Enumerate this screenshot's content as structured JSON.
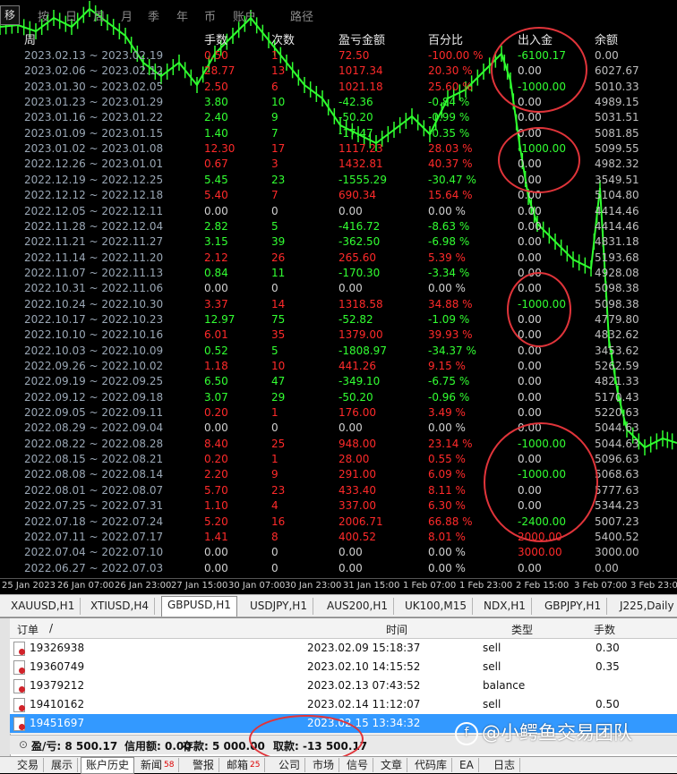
{
  "menu": {
    "left_box": "移",
    "items": [
      "按",
      "日",
      "周",
      "月",
      "季",
      "年",
      "币",
      "账户",
      "",
      "路径"
    ]
  },
  "columns": {
    "week": "周",
    "ratio": "手数",
    "count": "次数",
    "pnl": "盈亏金额",
    "pct": "百分比",
    "io": "出入金",
    "balance": "余额"
  },
  "rows": [
    {
      "week": "2023.02.13 ~ 2023.02.19",
      "ratio": "0.50",
      "count": "1",
      "pnl": "72.50",
      "pct": "-100.00 %",
      "io": "-6100.17",
      "balance": "0.00",
      "s": "neg",
      "ios": "pos"
    },
    {
      "week": "2023.02.06 ~ 2023.02.12",
      "ratio": "28.77",
      "count": "13",
      "pnl": "1017.34",
      "pct": "20.30 %",
      "io": "0.00",
      "balance": "6027.67",
      "s": "neg",
      "ios": "zero"
    },
    {
      "week": "2023.01.30 ~ 2023.02.05",
      "ratio": "2.50",
      "count": "6",
      "pnl": "1021.18",
      "pct": "25.60 %",
      "io": "-1000.00",
      "balance": "5010.33",
      "s": "neg",
      "ios": "pos"
    },
    {
      "week": "2023.01.23 ~ 2023.01.29",
      "ratio": "3.80",
      "count": "10",
      "pnl": "-42.36",
      "pct": "-0.84 %",
      "io": "0.00",
      "balance": "4989.15",
      "s": "pos",
      "ios": "zero"
    },
    {
      "week": "2023.01.16 ~ 2023.01.22",
      "ratio": "2.40",
      "count": "9",
      "pnl": "-50.20",
      "pct": "-0.99 %",
      "io": "0.00",
      "balance": "5031.51",
      "s": "pos",
      "ios": "zero"
    },
    {
      "week": "2023.01.09 ~ 2023.01.15",
      "ratio": "1.40",
      "count": "7",
      "pnl": "-17.47",
      "pct": "-0.35 %",
      "io": "0.00",
      "balance": "5081.85",
      "s": "pos",
      "ios": "zero"
    },
    {
      "week": "2023.01.02 ~ 2023.01.08",
      "ratio": "12.30",
      "count": "17",
      "pnl": "1117.23",
      "pct": "28.03 %",
      "io": "-1000.00",
      "balance": "5099.55",
      "s": "neg",
      "ios": "pos"
    },
    {
      "week": "2022.12.26 ~ 2023.01.01",
      "ratio": "0.67",
      "count": "3",
      "pnl": "1432.81",
      "pct": "40.37 %",
      "io": "0.00",
      "balance": "4982.32",
      "s": "neg",
      "ios": "zero"
    },
    {
      "week": "2022.12.19 ~ 2022.12.25",
      "ratio": "5.45",
      "count": "23",
      "pnl": "-1555.29",
      "pct": "-30.47 %",
      "io": "0.00",
      "balance": "3549.51",
      "s": "pos",
      "ios": "zero"
    },
    {
      "week": "2022.12.12 ~ 2022.12.18",
      "ratio": "5.40",
      "count": "7",
      "pnl": "690.34",
      "pct": "15.64 %",
      "io": "0.00",
      "balance": "5104.80",
      "s": "neg",
      "ios": "zero"
    },
    {
      "week": "2022.12.05 ~ 2022.12.11",
      "ratio": "0.00",
      "count": "0",
      "pnl": "0.00",
      "pct": "0.00 %",
      "io": "0.00",
      "balance": "4414.46",
      "s": "zero",
      "ios": "zero"
    },
    {
      "week": "2022.11.28 ~ 2022.12.04",
      "ratio": "2.82",
      "count": "5",
      "pnl": "-416.72",
      "pct": "-8.63 %",
      "io": "0.00",
      "balance": "4414.46",
      "s": "pos",
      "ios": "zero"
    },
    {
      "week": "2022.11.21 ~ 2022.11.27",
      "ratio": "3.15",
      "count": "39",
      "pnl": "-362.50",
      "pct": "-6.98 %",
      "io": "0.00",
      "balance": "4831.18",
      "s": "pos",
      "ios": "zero"
    },
    {
      "week": "2022.11.14 ~ 2022.11.20",
      "ratio": "2.12",
      "count": "26",
      "pnl": "265.60",
      "pct": "5.39 %",
      "io": "0.00",
      "balance": "5193.68",
      "s": "neg",
      "ios": "zero"
    },
    {
      "week": "2022.11.07 ~ 2022.11.13",
      "ratio": "0.84",
      "count": "11",
      "pnl": "-170.30",
      "pct": "-3.34 %",
      "io": "0.00",
      "balance": "4928.08",
      "s": "pos",
      "ios": "zero"
    },
    {
      "week": "2022.10.31 ~ 2022.11.06",
      "ratio": "0.00",
      "count": "0",
      "pnl": "0.00",
      "pct": "0.00 %",
      "io": "0.00",
      "balance": "5098.38",
      "s": "zero",
      "ios": "zero"
    },
    {
      "week": "2022.10.24 ~ 2022.10.30",
      "ratio": "3.37",
      "count": "14",
      "pnl": "1318.58",
      "pct": "34.88 %",
      "io": "-1000.00",
      "balance": "5098.38",
      "s": "neg",
      "ios": "pos"
    },
    {
      "week": "2022.10.17 ~ 2022.10.23",
      "ratio": "12.97",
      "count": "75",
      "pnl": "-52.82",
      "pct": "-1.09 %",
      "io": "0.00",
      "balance": "4779.80",
      "s": "pos",
      "ios": "zero"
    },
    {
      "week": "2022.10.10 ~ 2022.10.16",
      "ratio": "6.01",
      "count": "35",
      "pnl": "1379.00",
      "pct": "39.93 %",
      "io": "0.00",
      "balance": "4832.62",
      "s": "neg",
      "ios": "zero"
    },
    {
      "week": "2022.10.03 ~ 2022.10.09",
      "ratio": "0.52",
      "count": "5",
      "pnl": "-1808.97",
      "pct": "-34.37 %",
      "io": "0.00",
      "balance": "3453.62",
      "s": "pos",
      "ios": "zero"
    },
    {
      "week": "2022.09.26 ~ 2022.10.02",
      "ratio": "1.18",
      "count": "10",
      "pnl": "441.26",
      "pct": "9.15 %",
      "io": "0.00",
      "balance": "5262.59",
      "s": "neg",
      "ios": "zero"
    },
    {
      "week": "2022.09.19 ~ 2022.09.25",
      "ratio": "6.50",
      "count": "47",
      "pnl": "-349.10",
      "pct": "-6.75 %",
      "io": "0.00",
      "balance": "4821.33",
      "s": "pos",
      "ios": "zero"
    },
    {
      "week": "2022.09.12 ~ 2022.09.18",
      "ratio": "3.07",
      "count": "29",
      "pnl": "-50.20",
      "pct": "-0.96 %",
      "io": "0.00",
      "balance": "5170.43",
      "s": "pos",
      "ios": "zero"
    },
    {
      "week": "2022.09.05 ~ 2022.09.11",
      "ratio": "0.20",
      "count": "1",
      "pnl": "176.00",
      "pct": "3.49 %",
      "io": "0.00",
      "balance": "5220.63",
      "s": "neg",
      "ios": "zero"
    },
    {
      "week": "2022.08.29 ~ 2022.09.04",
      "ratio": "0.00",
      "count": "0",
      "pnl": "0.00",
      "pct": "0.00 %",
      "io": "0.00",
      "balance": "5044.63",
      "s": "zero",
      "ios": "zero"
    },
    {
      "week": "2022.08.22 ~ 2022.08.28",
      "ratio": "8.40",
      "count": "25",
      "pnl": "948.00",
      "pct": "23.14 %",
      "io": "-1000.00",
      "balance": "5044.63",
      "s": "neg",
      "ios": "pos"
    },
    {
      "week": "2022.08.15 ~ 2022.08.21",
      "ratio": "0.20",
      "count": "1",
      "pnl": "28.00",
      "pct": "0.55 %",
      "io": "0.00",
      "balance": "5096.63",
      "s": "neg",
      "ios": "zero"
    },
    {
      "week": "2022.08.08 ~ 2022.08.14",
      "ratio": "2.20",
      "count": "9",
      "pnl": "291.00",
      "pct": "6.09 %",
      "io": "-1000.00",
      "balance": "5068.63",
      "s": "neg",
      "ios": "pos"
    },
    {
      "week": "2022.08.01 ~ 2022.08.07",
      "ratio": "5.70",
      "count": "23",
      "pnl": "433.40",
      "pct": "8.11 %",
      "io": "0.00",
      "balance": "5777.63",
      "s": "neg",
      "ios": "zero"
    },
    {
      "week": "2022.07.25 ~ 2022.07.31",
      "ratio": "1.10",
      "count": "4",
      "pnl": "337.00",
      "pct": "6.30 %",
      "io": "0.00",
      "balance": "5344.23",
      "s": "neg",
      "ios": "zero"
    },
    {
      "week": "2022.07.18 ~ 2022.07.24",
      "ratio": "5.20",
      "count": "16",
      "pnl": "2006.71",
      "pct": "66.88 %",
      "io": "-2400.00",
      "balance": "5007.23",
      "s": "neg",
      "ios": "pos"
    },
    {
      "week": "2022.07.11 ~ 2022.07.17",
      "ratio": "1.41",
      "count": "8",
      "pnl": "400.52",
      "pct": "8.01 %",
      "io": "2000.00",
      "balance": "5400.52",
      "s": "neg",
      "ios": "neg"
    },
    {
      "week": "2022.07.04 ~ 2022.07.10",
      "ratio": "0.00",
      "count": "0",
      "pnl": "0.00",
      "pct": "0.00 %",
      "io": "3000.00",
      "balance": "3000.00",
      "s": "zero",
      "ios": "neg"
    },
    {
      "week": "2022.06.27 ~ 2022.07.03",
      "ratio": "0.00",
      "count": "0",
      "pnl": "0.00",
      "pct": "0.00 %",
      "io": "0.00",
      "balance": "0.00",
      "s": "zero",
      "ios": "zero"
    }
  ],
  "xaxis": [
    "25 Jan 2023",
    "26 Jan 07:00",
    "26 Jan 23:00",
    "27 Jan 15:00",
    "30 Jan 07:00",
    "30 Jan 23:00",
    "31 Jan 15:00",
    "1 Feb 07:00",
    "1 Feb 23:00",
    "2 Feb 15:00",
    "3 Feb 07:00",
    "3 Feb 23:00"
  ],
  "symbol_tabs": [
    "XAUUSD,H1",
    "XTIUSD,H4",
    "GBPUSD,H1",
    "USDJPY,H1",
    "AUS200,H1",
    "UK100,M15",
    "NDX,H1",
    "GBPJPY,H1",
    "J225,Daily"
  ],
  "active_symbol": "GBPUSD,H1",
  "terminal": {
    "columns": {
      "order": "订单",
      "sort": "/",
      "time": "时间",
      "type": "类型",
      "lots": "手数"
    },
    "orders": [
      {
        "order": "19326938",
        "time": "2023.02.09 15:18:37",
        "type": "sell",
        "lots": "0.30"
      },
      {
        "order": "19360749",
        "time": "2023.02.10 14:15:52",
        "type": "sell",
        "lots": "0.35"
      },
      {
        "order": "19379212",
        "time": "2023.02.13 07:43:52",
        "type": "balance",
        "lots": ""
      },
      {
        "order": "19410162",
        "time": "2023.02.14 11:12:07",
        "type": "sell",
        "lots": "0.50"
      },
      {
        "order": "19451697",
        "time": "2023.02.15 13:34:32",
        "type": "",
        "lots": ""
      }
    ],
    "summary": {
      "pl": "盈/亏: 8 500.17",
      "credit": "信用额: 0.00",
      "deposit": "存款: 5 000.00",
      "withdraw": "取款: -13 500.17"
    }
  },
  "bottom_tabs": [
    {
      "label": "交易",
      "badge": ""
    },
    {
      "label": "展示",
      "badge": ""
    },
    {
      "label": "账户历史",
      "badge": ""
    },
    {
      "label": "新闻",
      "badge": "58"
    },
    {
      "label": "警报",
      "badge": ""
    },
    {
      "label": "邮箱",
      "badge": "25"
    },
    {
      "label": "公司",
      "badge": ""
    },
    {
      "label": "市场",
      "badge": ""
    },
    {
      "label": "信号",
      "badge": ""
    },
    {
      "label": "文章",
      "badge": ""
    },
    {
      "label": "代码库",
      "badge": ""
    },
    {
      "label": "EA",
      "badge": ""
    },
    {
      "label": "日志",
      "badge": ""
    }
  ],
  "active_bottom": "账户历史",
  "watermark": "@小鳄鱼交易团队",
  "colors": {
    "positive": "#32ff32",
    "negative": "#ff2a2a",
    "circle": "#e0343a",
    "selected": "#3399ff"
  }
}
